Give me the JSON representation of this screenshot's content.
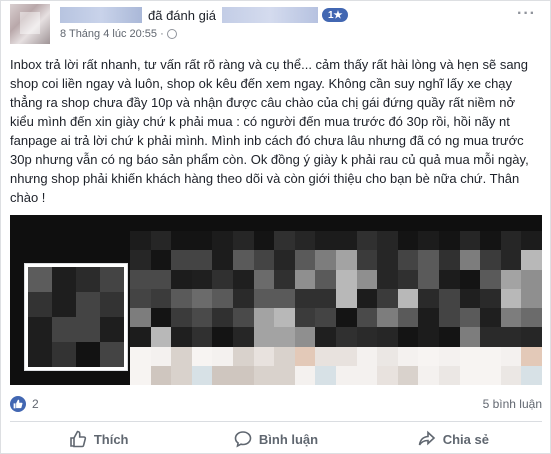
{
  "header": {
    "reviewed_text": "đã đánh giá",
    "badge": "1★",
    "timestamp": "8 Tháng 4 lúc 20:55 ·"
  },
  "post": {
    "text": "Inbox trả lời rất nhanh, tư vấn rất rõ ràng và cụ thể... cảm thấy rất hài lòng và hẹn sẽ sang shop coi liền ngay và luôn, shop ok kêu đến xem ngay. Không cần suy nghĩ lấy xe chạy thẳng ra shop chưa đầy 10p và nhận được câu chào của chị gái đứng quầy rất niềm nở kiểu mình đến xin giày chứ k phải mua : có người đến mua trước đó 30p rồi, hồi nãy nt fanpage ai trả lời chứ k phải mình. Mình inb cách đó chưa lâu nhưng đã có ng mua trước 30p nhưng vẫn có ng báo sản phẩm còn. Ok đồng ý giày k phải rau củ quả mua mỗi ngày, nhưng shop phải khiến khách hàng theo dõi và còn giới thiệu cho bạn bè nữa chứ. Thân chào !"
  },
  "stats": {
    "like_count": "2",
    "comment_count": "5 bình luận"
  },
  "actions": {
    "like": "Thích",
    "comment": "Bình luận",
    "share": "Chia sẻ"
  },
  "colors": {
    "brand": "#4267b2",
    "muted": "#616770",
    "text": "#1d2129"
  },
  "icons": {
    "like": "thumbs-up-icon",
    "comment": "speech-bubble-icon",
    "share": "share-arrow-icon",
    "privacy": "globe-icon",
    "more": "more-options-icon"
  }
}
